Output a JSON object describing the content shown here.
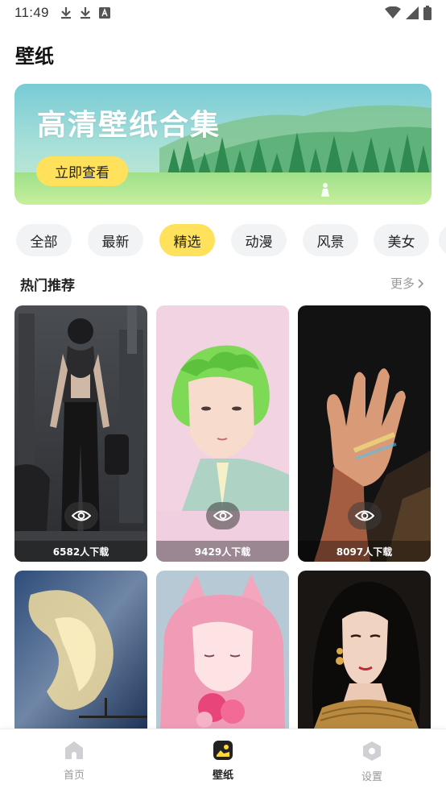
{
  "status_bar": {
    "time": "11:49",
    "icons": [
      "download-icon",
      "download-icon",
      "text-a-icon",
      "wifi-icon",
      "signal-icon",
      "battery-icon"
    ]
  },
  "page": {
    "title": "壁纸"
  },
  "banner": {
    "title": "高清壁纸合集",
    "button_label": "立即查看",
    "colors": {
      "sky_top": "#7fd0d6",
      "meadow": "#9adf8c",
      "button": "#ffe15b"
    }
  },
  "categories": {
    "items": [
      "全部",
      "最新",
      "精选",
      "动漫",
      "风景",
      "美女"
    ],
    "active": "精选",
    "active_color": "#ffe15b"
  },
  "section": {
    "title": "热门推荐",
    "more_label": "更多"
  },
  "wallpapers": [
    {
      "downloads_label": "6582人下载",
      "subject": "cyberpunk-girl"
    },
    {
      "downloads_label": "9429人下载",
      "subject": "green-hair-illustration"
    },
    {
      "downloads_label": "8097人下载",
      "subject": "hand-in-light"
    },
    {
      "subject": "golden-clouds"
    },
    {
      "subject": "pink-fox-girl"
    },
    {
      "subject": "woman-portrait"
    }
  ],
  "bottom_nav": {
    "items": [
      {
        "label": "首页",
        "icon": "home-icon"
      },
      {
        "label": "壁纸",
        "icon": "wallpaper-icon"
      },
      {
        "label": "设置",
        "icon": "settings-icon"
      }
    ],
    "active": "壁纸"
  }
}
